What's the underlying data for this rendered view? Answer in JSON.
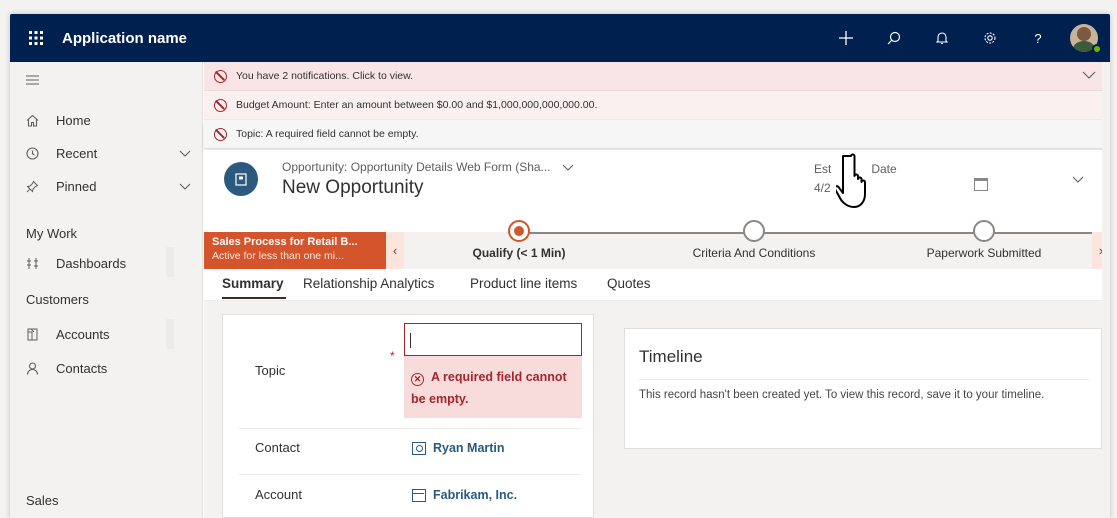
{
  "topbar": {
    "app_name": "Application name",
    "waffle_icon": "waffle-icon",
    "icons": [
      "plus-icon",
      "search-icon",
      "bell-icon",
      "gear-icon",
      "help-icon"
    ]
  },
  "sidebar": {
    "items": [
      {
        "label": "Home",
        "icon": "home-icon"
      },
      {
        "label": "Recent",
        "icon": "clock-icon"
      },
      {
        "label": "Pinned",
        "icon": "pin-icon"
      }
    ],
    "groups": [
      {
        "title": "My Work",
        "items": [
          {
            "label": "Dashboards",
            "icon": "dashboard-icon"
          }
        ]
      },
      {
        "title": "Customers",
        "items": [
          {
            "label": "Accounts",
            "icon": "account-icon"
          },
          {
            "label": "Contacts",
            "icon": "contact-icon"
          }
        ]
      },
      {
        "title": "Sales",
        "items": []
      }
    ]
  },
  "notifications": [
    "You have 2 notifications. Click to view.",
    "Budget Amount: Enter an amount between $0.00 and $1,000,000,000,000.00.",
    "Topic: A required field cannot be empty."
  ],
  "header": {
    "form_selector": "Opportunity: Opportunity Details Web Form (Sha...",
    "title": "New Opportunity",
    "est_label_left": "Est",
    "est_label_right": "Date",
    "est_value": "4/2"
  },
  "bpf": {
    "process_name": "Sales Process for Retail B...",
    "process_status": "Active for less than one mi...",
    "stages": [
      "Qualify  (< 1 Min)",
      "Criteria And Conditions",
      "Paperwork Submitted"
    ],
    "active_stage": 0
  },
  "tabs": [
    "Summary",
    "Relationship Analytics",
    "Product line items",
    "Quotes"
  ],
  "form": {
    "topic_label": "Topic",
    "required_marker": "*",
    "topic_value": "",
    "topic_error": "A required field cannot be empty.",
    "contact_label": "Contact",
    "contact_value": "Ryan Martin",
    "account_label": "Account",
    "account_value": "Fabrikam, Inc."
  },
  "timeline": {
    "title": "Timeline",
    "message": "This record hasn't been created yet.  To view this record, save it to your timeline."
  },
  "colors": {
    "topbar": "#002050",
    "accent_orange": "#d4552c",
    "error_red": "#a4262c",
    "link_blue": "#2b5a7e"
  }
}
